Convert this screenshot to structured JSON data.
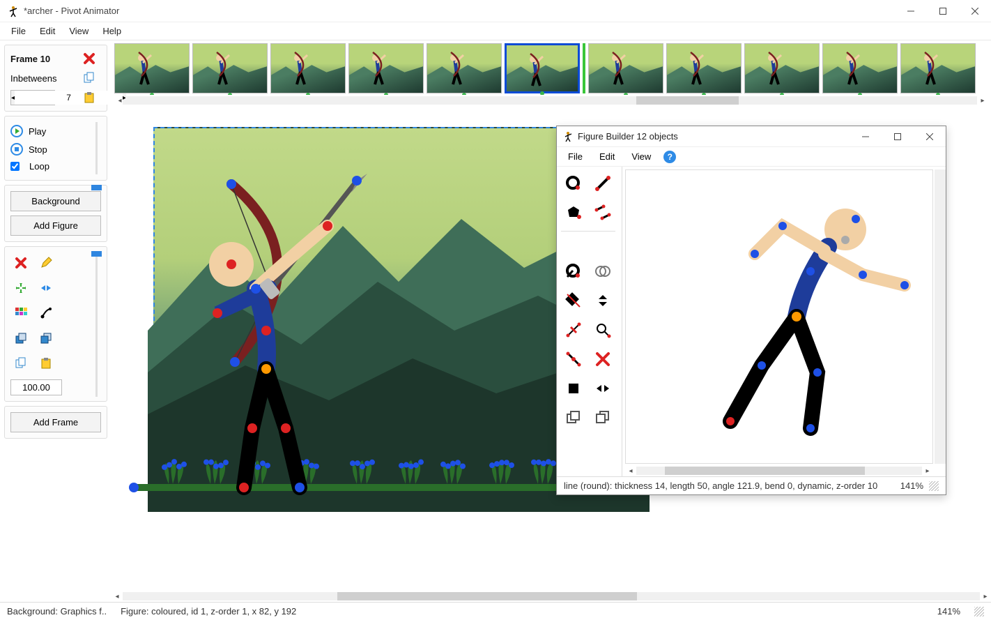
{
  "window": {
    "title": "*archer - Pivot Animator"
  },
  "menubar": {
    "file": "File",
    "edit": "Edit",
    "view": "View",
    "help": "Help"
  },
  "frame_panel": {
    "frame_label": "Frame 10",
    "inbetweens_label": "Inbetweens",
    "inbetweens_value": "7"
  },
  "play_panel": {
    "play": "Play",
    "stop": "Stop",
    "loop": "Loop",
    "loop_checked": true
  },
  "buttons": {
    "background": "Background",
    "add_figure": "Add Figure",
    "add_frame": "Add Frame"
  },
  "tool_panel": {
    "scale_value": "100.00"
  },
  "timeline": {
    "frame_count": 11,
    "selected_index": 5,
    "cursor_after_index": 5
  },
  "statusbar": {
    "background": "Background: Graphics f..",
    "figure": "Figure: coloured,  id 1,  z-order 1,  x 82, y 192",
    "zoom": "141%"
  },
  "figure_builder": {
    "title": "Figure Builder   12 objects",
    "menubar": {
      "file": "File",
      "edit": "Edit",
      "view": "View"
    },
    "status": "line (round): thickness 14, length 50, angle 121.9, bend 0, dynamic, z-order 10",
    "zoom": "141%"
  }
}
